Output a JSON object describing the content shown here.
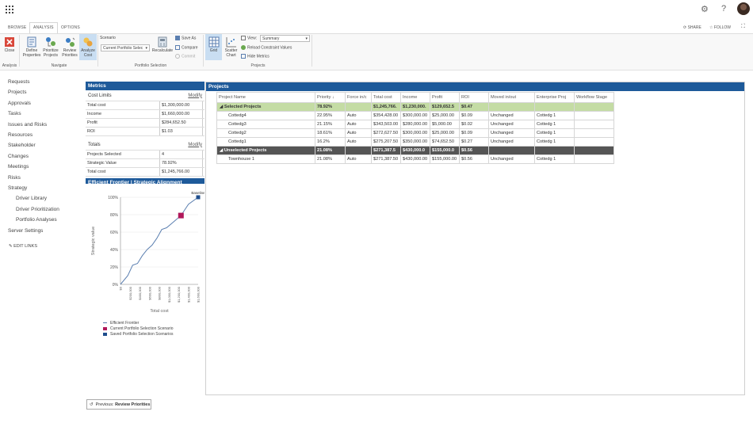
{
  "topbar": {
    "settings_icon": "gear-icon",
    "help_label": "?"
  },
  "tabs": {
    "browse": "BROWSE",
    "analysis": "ANALYSIS",
    "options": "OPTIONS",
    "share": "SHARE",
    "follow": "FOLLOW"
  },
  "ribbon": {
    "close": "Close",
    "define": "Define Properties",
    "prioritize": "Prioritize Projects",
    "review": "Review Priorities",
    "analyze": "Analyze Cost",
    "scenario_label": "Scenario",
    "scenario_value": "Current Portfolio Selec",
    "recalculate": "Recalculate",
    "save_as": "Save As",
    "compare": "Compare",
    "commit": "Commit",
    "grid": "Grid",
    "scatter": "Scatter Chart",
    "view_label": "View:",
    "view_value": "Summary",
    "reload": "Reload Constraint Values",
    "hide_metrics": "Hide Metrics",
    "groups": {
      "analysis": "Analysis",
      "navigate": "Navigate",
      "portfolio": "Portfolio Selection",
      "projects": "Projects"
    }
  },
  "nav": {
    "items": [
      "Requests",
      "Projects",
      "Approvals",
      "Tasks",
      "Issues and Risks",
      "Resources",
      "Stakeholder",
      "Changes",
      "Meetings",
      "Risks",
      "Strategy"
    ],
    "sub": [
      "Driver Library",
      "Driver Prioritization",
      "Portfolio Analyses"
    ],
    "server": "Server Settings",
    "edit": "EDIT LINKS"
  },
  "metrics": {
    "title": "Metrics",
    "cost_limits": "Cost Limits",
    "modify": "Modify",
    "limits": [
      [
        "Total cost",
        "$1,300,000.00"
      ],
      [
        "Income",
        "$1,660,000.00"
      ],
      [
        "Profit",
        "$284,652.50"
      ],
      [
        "ROI",
        "$1.03"
      ]
    ],
    "totals": "Totals",
    "totals_rows": [
      [
        "Projects Selected",
        "4"
      ],
      [
        "Strategic Value",
        "78.92%"
      ],
      [
        "Total cost",
        "$1,245,766.00"
      ]
    ],
    "frontier_title": "Efficient Frontier",
    "sep": " | ",
    "alignment_title": "Strategic Alignment"
  },
  "chart_data": {
    "type": "line",
    "ylabel": "Strategic value",
    "xlabel": "Total cost",
    "y_ticks": [
      "0%",
      "20%",
      "40%",
      "60%",
      "80%",
      "100%"
    ],
    "x_ticks": [
      "$0",
      "$200,000",
      "$400,000",
      "$600,000",
      "$800,000",
      "$1,000,000",
      "$1,200,000",
      "$1,400,000",
      "$1,600,000"
    ],
    "ylim": [
      0,
      100
    ],
    "xlim": [
      0,
      1600000
    ],
    "series": [
      {
        "name": "Efficient Frontier",
        "x": [
          0,
          150000,
          250000,
          350000,
          450000,
          550000,
          650000,
          750000,
          850000,
          950000,
          1100000,
          1245766,
          1400000,
          1600000
        ],
        "y": [
          0,
          10,
          22,
          24,
          33,
          40,
          45,
          53,
          63,
          65,
          72,
          79,
          92,
          100
        ]
      }
    ],
    "current": {
      "name": "Current Portfolio Selection Scenario",
      "x": 1245766,
      "y": 79
    },
    "saved": {
      "name": "Saved Portfolio Selection Scenarios",
      "label": "Baseline",
      "x": 1600000,
      "y": 100
    },
    "colors": {
      "line": "#5b7fb0",
      "current": "#b0185a",
      "saved": "#1e4d8c"
    }
  },
  "projects": {
    "title": "Projects",
    "headers": [
      "Project Name",
      "Priority",
      "Force in/c",
      "Total cost",
      "Income",
      "Profit",
      "ROI",
      "Moved in/out",
      "Enterprise Proj",
      "Workflow Stage"
    ],
    "selected_group": [
      "Selected Projects",
      "78.92%",
      "",
      "$1,245,766.",
      "$1,230,000.",
      "$129,652.5",
      "$0.47",
      "",
      "",
      ""
    ],
    "selected": [
      [
        "Cottedg4",
        "22.95%",
        "Auto",
        "$354,428.00",
        "$300,000.00",
        "$25,000.00",
        "$0.09",
        "Unchanged",
        "Cottedg 1",
        ""
      ],
      [
        "Cottedg3",
        "21.15%",
        "Auto",
        "$343,503.00",
        "$280,000.00",
        "$5,000.00",
        "$0.02",
        "Unchanged",
        "Cottedg 1",
        ""
      ],
      [
        "Cottedg2",
        "18.61%",
        "Auto",
        "$272,627.50",
        "$300,000.00",
        "$25,000.00",
        "$0.09",
        "Unchanged",
        "Cottedg 1",
        ""
      ],
      [
        "Cottedg1",
        "16.2%",
        "Auto",
        "$275,207.50",
        "$350,000.00",
        "$74,652.50",
        "$0.27",
        "Unchanged",
        "Cottedg 1",
        ""
      ]
    ],
    "unselected_group": [
      "Unselected Projects",
      "21.08%",
      "",
      "$271,387.5",
      "$430,000.0",
      "$155,000.0",
      "$0.56",
      "",
      "",
      ""
    ],
    "unselected": [
      [
        "Townhouse 1",
        "21.08%",
        "Auto",
        "$271,387.50",
        "$430,000.00",
        "$155,000.00",
        "$0.56",
        "Unchanged",
        "Cottedg 1",
        ""
      ]
    ]
  },
  "footer": {
    "prev": "Previous:",
    "prev_target": "Review Priorities"
  }
}
